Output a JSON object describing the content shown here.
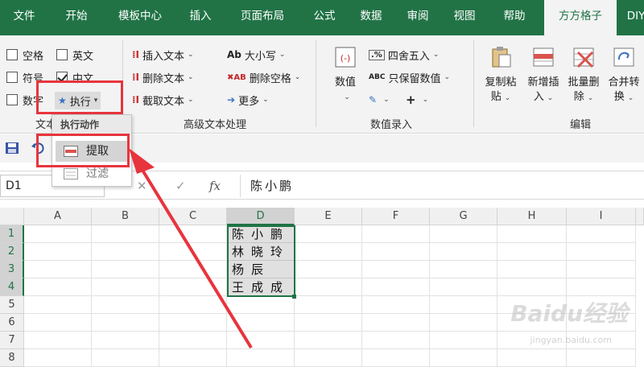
{
  "tabs": [
    "文件",
    "开始",
    "模板中心",
    "插入",
    "页面布局",
    "公式",
    "数据",
    "审阅",
    "视图",
    "帮助",
    "方方格子",
    "DIY"
  ],
  "active_tab": "方方格子",
  "text_group": {
    "checkboxes": [
      {
        "label": "空格",
        "checked": false
      },
      {
        "label": "英文",
        "checked": false
      },
      {
        "label": "符号",
        "checked": false
      },
      {
        "label": "中文",
        "checked": true
      },
      {
        "label": "数字",
        "checked": false
      }
    ],
    "execute_label": "执行",
    "group_label": "文本"
  },
  "advanced_text": {
    "items": [
      "插入文本",
      "删除文本",
      "截取文本"
    ],
    "items2": [
      "大小写",
      "删除空格",
      "更多"
    ],
    "group_label": "高级文本处理"
  },
  "numeric": {
    "value_label": "数值",
    "round_label": "四舍五入",
    "keep_label": "只保留数值",
    "group_label": "数值录入"
  },
  "edit": {
    "buttons": [
      {
        "line1": "复制粘",
        "line2": "贴"
      },
      {
        "line1": "新增插",
        "line2": "入"
      },
      {
        "line1": "批量删",
        "line2": "除"
      },
      {
        "line1": "合并转",
        "line2": "换"
      }
    ],
    "group_label": "编辑"
  },
  "dropdown": {
    "header": "执行动作",
    "items": [
      "提取",
      "过滤"
    ]
  },
  "formula_bar": {
    "name_box": "D1",
    "fx": "fx",
    "content": "陈小鹏"
  },
  "grid": {
    "columns": [
      "A",
      "B",
      "C",
      "D",
      "E",
      "F",
      "G",
      "H",
      "I"
    ],
    "rows": [
      "1",
      "2",
      "3",
      "4",
      "5",
      "6",
      "7",
      "8"
    ],
    "d_values": [
      "陈小鹏",
      "林晓玲",
      "杨辰",
      "王成成"
    ]
  },
  "watermark": {
    "main": "Baidu经验",
    "sub": "jingyan.baidu.com"
  },
  "colors": {
    "excel_green": "#217346",
    "highlight_red": "#e8343d"
  }
}
